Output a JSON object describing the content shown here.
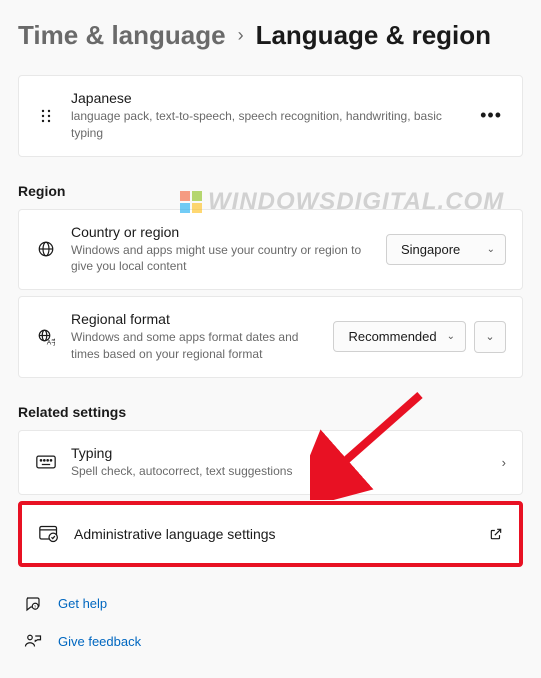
{
  "breadcrumb": {
    "parent": "Time & language",
    "current": "Language & region"
  },
  "languageCard": {
    "title": "Japanese",
    "subtitle": "language pack, text-to-speech, speech recognition, handwriting, basic typing"
  },
  "regionSection": {
    "heading": "Region",
    "country": {
      "title": "Country or region",
      "subtitle": "Windows and apps might use your country or region to give you local content",
      "value": "Singapore"
    },
    "format": {
      "title": "Regional format",
      "subtitle": "Windows and some apps format dates and times based on your regional format",
      "value": "Recommended"
    }
  },
  "relatedSection": {
    "heading": "Related settings",
    "typing": {
      "title": "Typing",
      "subtitle": "Spell check, autocorrect, text suggestions"
    },
    "admin": {
      "title": "Administrative language settings"
    }
  },
  "links": {
    "help": "Get help",
    "feedback": "Give feedback"
  },
  "watermark": "WINDOWSDIGITAL.COM"
}
